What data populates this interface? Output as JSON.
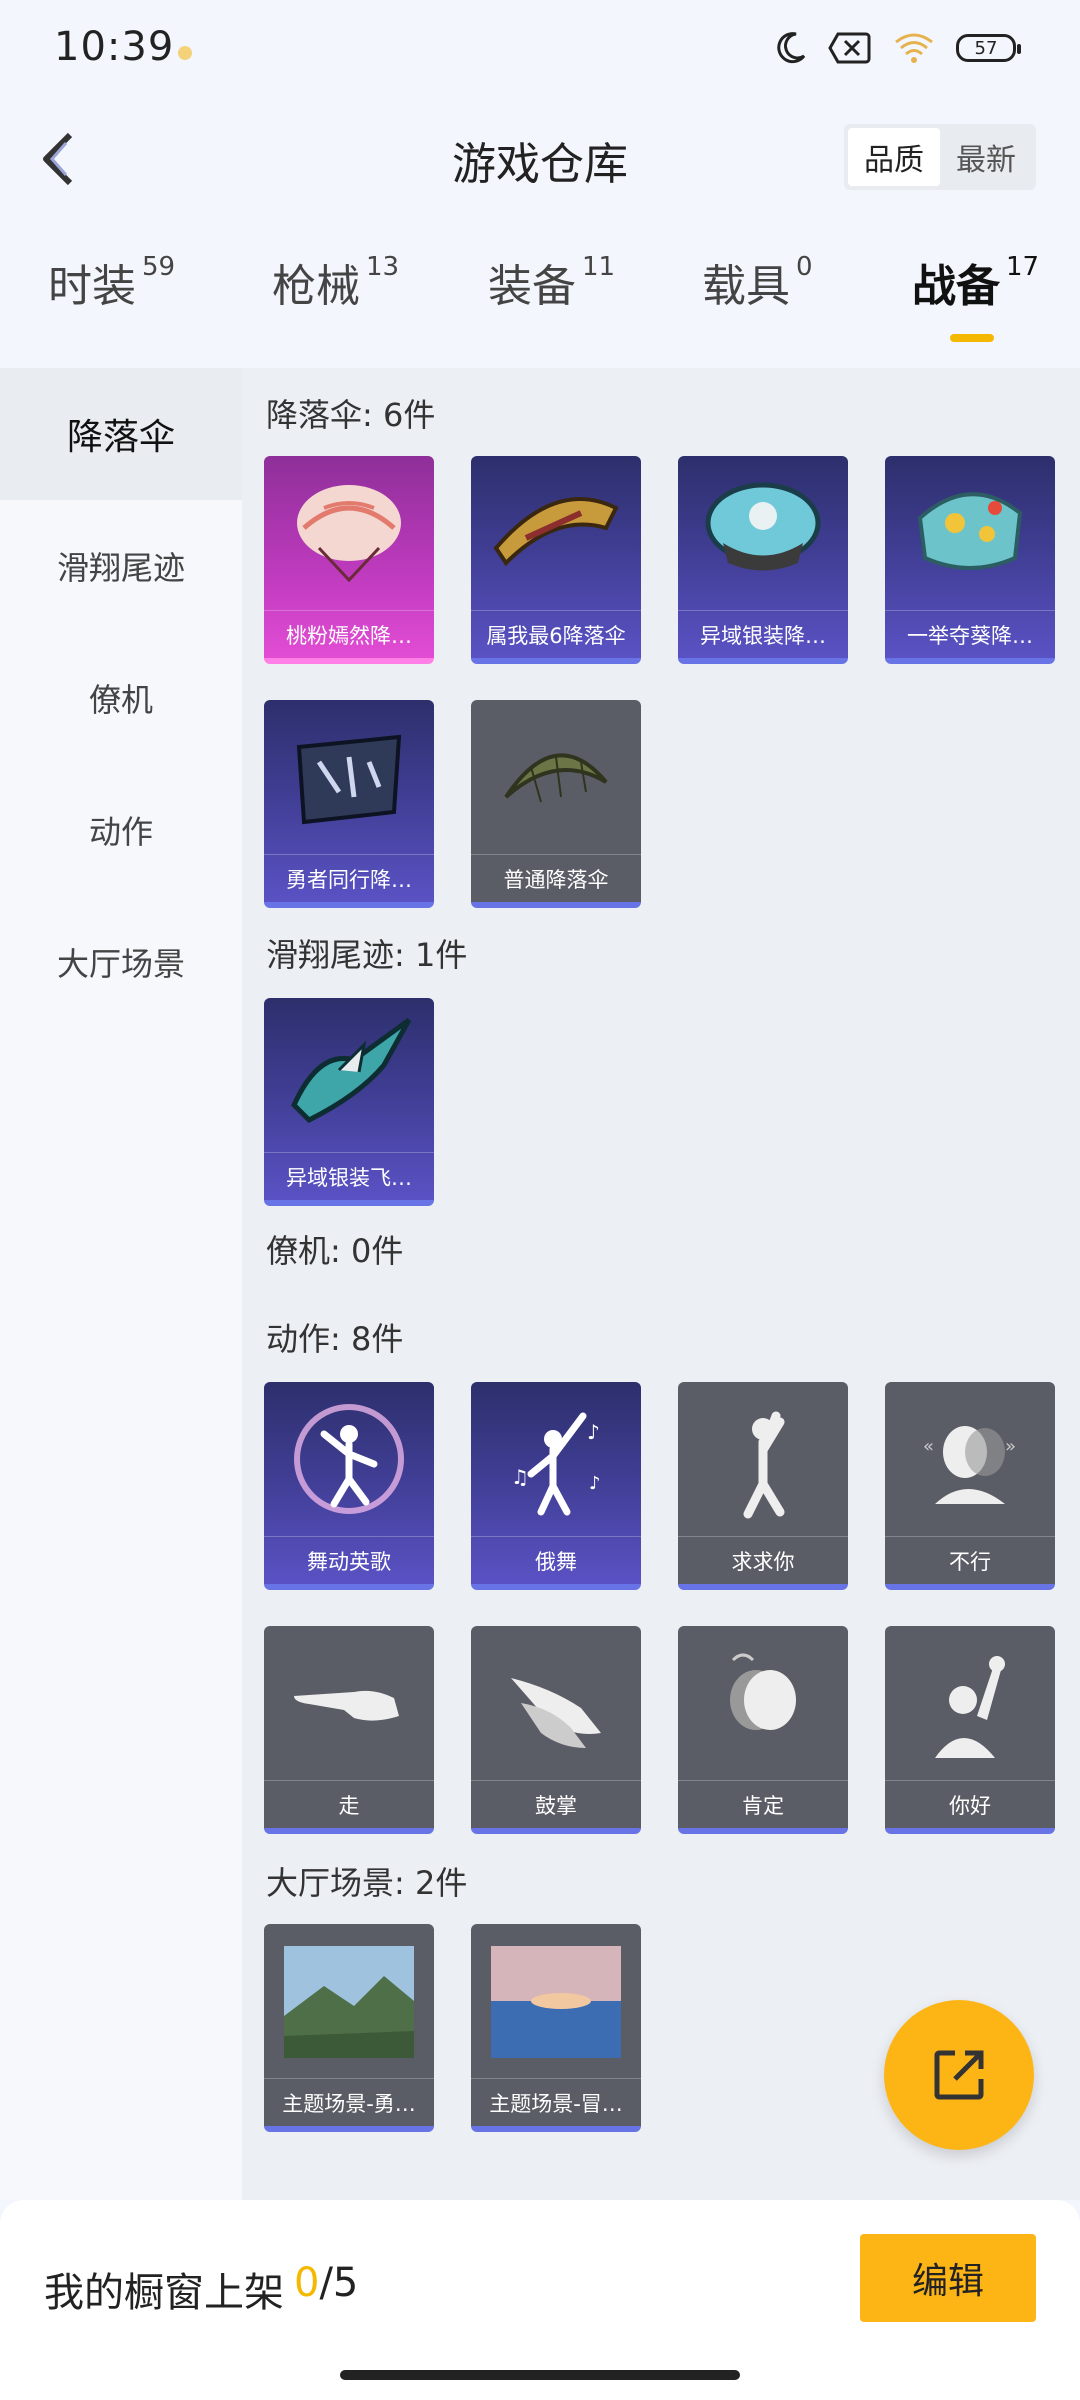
{
  "status": {
    "time": "10:39",
    "battery": "57"
  },
  "header": {
    "title": "游戏仓库",
    "sort_quality": "品质",
    "sort_newest": "最新"
  },
  "tabs": [
    {
      "label": "时装",
      "count": "59"
    },
    {
      "label": "枪械",
      "count": "13"
    },
    {
      "label": "装备",
      "count": "11"
    },
    {
      "label": "载具",
      "count": "0"
    },
    {
      "label": "战备",
      "count": "17"
    }
  ],
  "sidebar": {
    "items": [
      {
        "label": "降落伞"
      },
      {
        "label": "滑翔尾迹"
      },
      {
        "label": "僚机"
      },
      {
        "label": "动作"
      },
      {
        "label": "大厅场景"
      }
    ]
  },
  "sections": {
    "parachute": {
      "title": "降落伞: 6件",
      "items": [
        {
          "name": "桃粉嫣然降…"
        },
        {
          "name": "属我最6降落伞"
        },
        {
          "name": "异域银装降…"
        },
        {
          "name": "一举夺葵降…"
        },
        {
          "name": "勇者同行降…"
        },
        {
          "name": "普通降落伞"
        }
      ]
    },
    "trail": {
      "title": "滑翔尾迹: 1件",
      "items": [
        {
          "name": "异域银装飞…"
        }
      ]
    },
    "wingman": {
      "title": "僚机: 0件"
    },
    "emote": {
      "title": "动作: 8件",
      "items": [
        {
          "name": "舞动英歌"
        },
        {
          "name": "俄舞"
        },
        {
          "name": "求求你"
        },
        {
          "name": "不行"
        },
        {
          "name": "走"
        },
        {
          "name": "鼓掌"
        },
        {
          "name": "肯定"
        },
        {
          "name": "你好"
        }
      ]
    },
    "lobby": {
      "title": "大厅场景: 2件",
      "items": [
        {
          "name": "主题场景-勇…"
        },
        {
          "name": "主题场景-冒…"
        }
      ]
    }
  },
  "bottom": {
    "showcase_label": "我的橱窗上架",
    "showcase_count": "0",
    "showcase_total": "/5",
    "edit_label": "编辑"
  },
  "colors": {
    "accent": "#fcb514",
    "card_border": "#6874e6",
    "card_grey": "#5b5d66",
    "card_purple": "#3f3d92",
    "card_pink": "#c03bbf"
  }
}
